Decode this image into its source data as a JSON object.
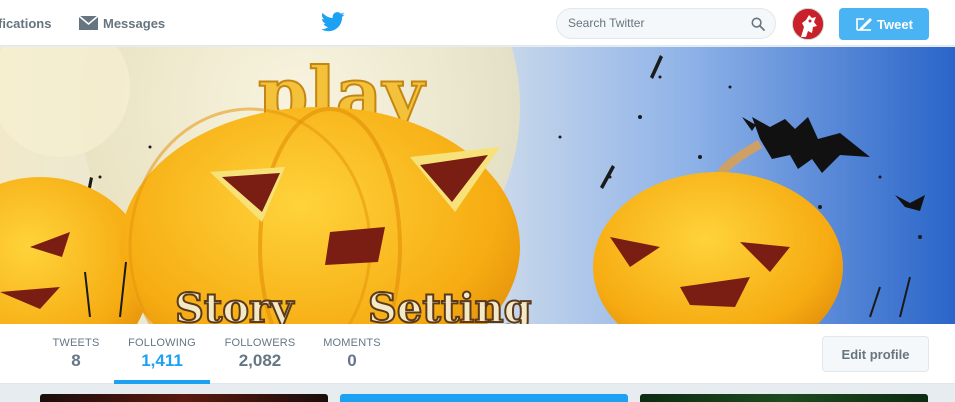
{
  "nav": {
    "notifications_label": "fications",
    "messages_label": "Messages"
  },
  "search": {
    "placeholder": "Search Twitter"
  },
  "tweet_button": {
    "label": "Tweet"
  },
  "banner": {
    "title_text": "play",
    "story_text": "Story",
    "setting_text": "Setting"
  },
  "profile_nav": {
    "stats": [
      {
        "label": "TWEETS",
        "value": "8"
      },
      {
        "label": "FOLLOWING",
        "value": "1,411"
      },
      {
        "label": "FOLLOWERS",
        "value": "2,082"
      },
      {
        "label": "MOMENTS",
        "value": "0"
      }
    ],
    "active_stat": "FOLLOWING",
    "edit_profile_label": "Edit profile"
  },
  "colors": {
    "twitter_blue": "#1da1f2",
    "tweet_button": "#4ab3f4",
    "pumpkin": "#f7b117",
    "sky": "#3a7ad6"
  },
  "icons": {
    "notifications": "bell-icon",
    "messages": "envelope-icon",
    "logo": "twitter-bird-icon",
    "search": "magnifier-icon",
    "compose": "compose-icon"
  }
}
